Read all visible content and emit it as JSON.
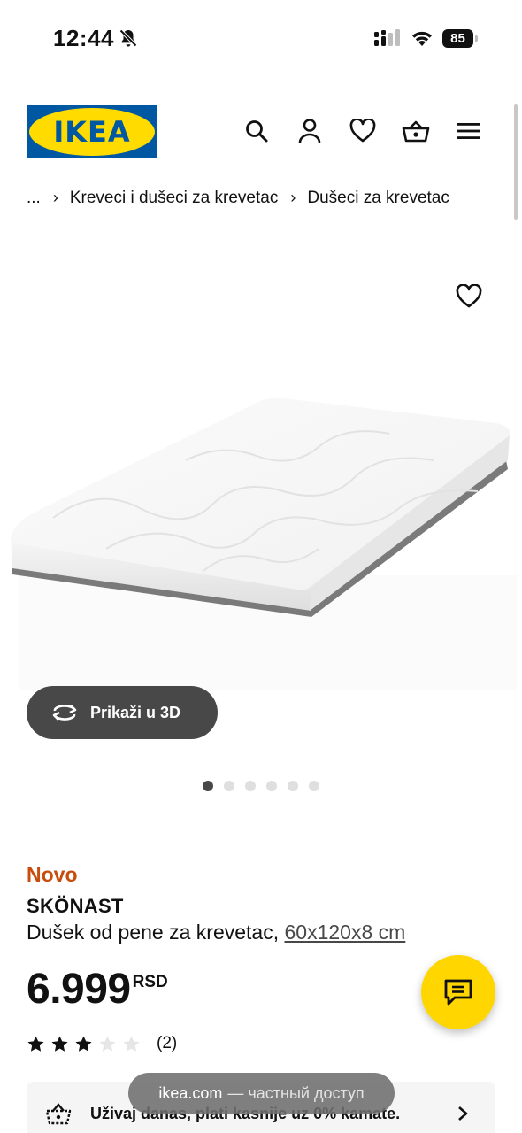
{
  "status_bar": {
    "time": "12:44",
    "battery": "85",
    "icons": [
      "bell-slash-icon",
      "signal-icon",
      "wifi-icon",
      "battery-icon"
    ]
  },
  "header": {
    "logo_text": "IKEA",
    "brand_colors": {
      "blue": "#0058a3",
      "yellow": "#ffdb00"
    },
    "icons": [
      "search-icon",
      "user-icon",
      "heart-icon",
      "basket-icon",
      "menu-icon"
    ]
  },
  "breadcrumb": {
    "ellipsis": "...",
    "items": [
      "Kreveci i dušeci za krevetac",
      "Dušeci za krevetac"
    ]
  },
  "gallery": {
    "view_3d_label": "Prikaži u 3D",
    "dot_count": 6,
    "active_index": 0
  },
  "product": {
    "badge": "Novo",
    "badge_color": "#c84c0c",
    "name": "SKÖNAST",
    "description": "Dušek od pene za krevetac,",
    "size": "60x120x8 cm",
    "price": "6.999",
    "currency": "RSD",
    "rating": 3,
    "rating_max": 5,
    "rating_count": "(2)"
  },
  "promo": {
    "text": "Uživaj danas, plati kasnije uz 0% kamate."
  },
  "toast": {
    "domain": "ikea.com",
    "suffix": "— частный доступ"
  },
  "accent": {
    "chat_fab": "#ffd600"
  }
}
